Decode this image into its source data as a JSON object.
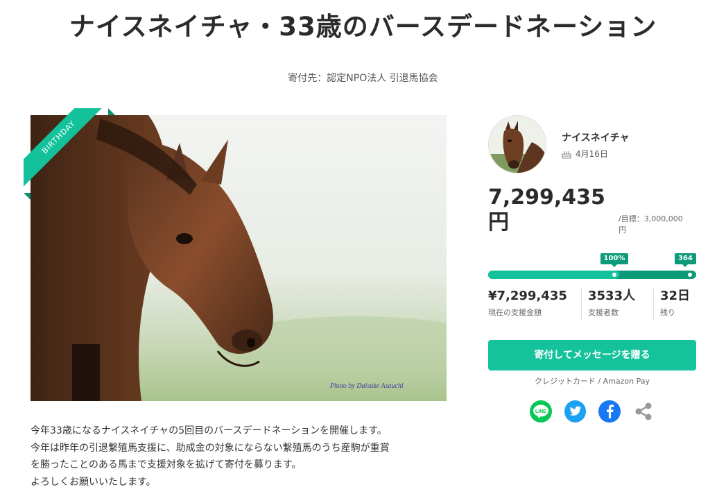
{
  "page": {
    "title": "ナイスネイチャ・33歳のバースデードネーション",
    "beneficiary": "寄付先：認定NPO法人 引退馬協会"
  },
  "hero": {
    "ribbon": "BIRTHDAY",
    "photo_credit": "Photo by Daisuke Asauchi"
  },
  "description": {
    "lines": [
      "今年33歳になるナイスネイチャの5回目のバースデードネーションを開催します。",
      "今年は昨年の引退繋殖馬支援に、助成金の対象にならない繋殖馬のうち産駒が重賞",
      "を勝ったことのある馬まで支援対象を拡げて寄付を募ります。",
      "よろしくお願いいたします。"
    ]
  },
  "profile": {
    "name": "ナイスネイチャ",
    "birthday": "4月16日",
    "birthday_icon": "cake-icon"
  },
  "funding": {
    "amount_number": "7,299,435",
    "amount_unit": "円",
    "goal_label": "/目標：3,000,000",
    "goal_unit": "円",
    "progress_percent_label": "100%",
    "days_label": "364",
    "progress_fraction": 1.0,
    "elapsed_fraction": 0.97,
    "stats": [
      {
        "value": "¥7,299,435",
        "label": "現在の支援金額"
      },
      {
        "value": "3533人",
        "label": "支援者数"
      },
      {
        "value": "32日",
        "label": "残り"
      }
    ]
  },
  "actions": {
    "donate_button": "寄付してメッセージを贈る",
    "payment_methods": "クレジットカード / Amazon Pay"
  },
  "share": {
    "line_label": "LINE",
    "icons": [
      "line-icon",
      "twitter-icon",
      "facebook-icon",
      "share-icon"
    ]
  },
  "colors": {
    "accent": "#14c39c",
    "accent_dark": "#0d9a78",
    "line": "#06c755",
    "twitter": "#1da1f2",
    "facebook": "#1877f2",
    "share": "#999999"
  }
}
